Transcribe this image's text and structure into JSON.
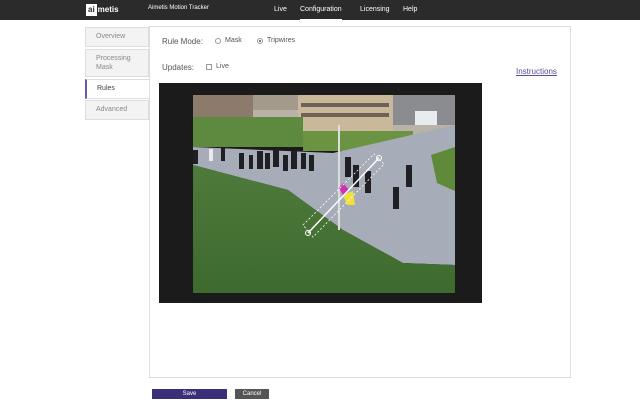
{
  "header": {
    "logo": {
      "highlight": "ai",
      "rest": "metis"
    },
    "product_name": "Aimetis Motion Tracker",
    "nav": [
      "Live",
      "Configuration",
      "Licensing",
      "Help"
    ],
    "active_nav": "Configuration"
  },
  "tabs": [
    {
      "label": "Overview",
      "active": false
    },
    {
      "label": "Processing Mask",
      "active": false
    },
    {
      "label": "Rules",
      "active": true
    },
    {
      "label": "Advanced",
      "active": false
    }
  ],
  "rule_mode": {
    "label": "Rule Mode:",
    "options": [
      {
        "label": "Mask",
        "selected": false
      },
      {
        "label": "Tripwires",
        "selected": true
      }
    ]
  },
  "updates": {
    "label": "Updates:",
    "live_label": "Live",
    "live_checked": false
  },
  "instructions_link": "Instructions",
  "buttons": {
    "save": "Save",
    "cancel": "Cancel"
  },
  "colors": {
    "topbar": "#2b2b2b",
    "accent": "#3b2f7a",
    "cancel": "#555555",
    "tripwire": "#ffffff"
  }
}
